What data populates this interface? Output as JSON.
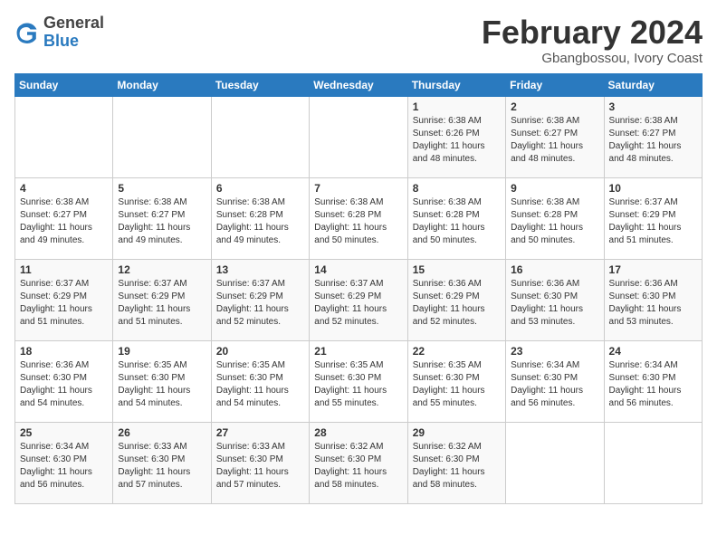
{
  "logo": {
    "general": "General",
    "blue": "Blue"
  },
  "title": "February 2024",
  "subtitle": "Gbangbossou, Ivory Coast",
  "days_header": [
    "Sunday",
    "Monday",
    "Tuesday",
    "Wednesday",
    "Thursday",
    "Friday",
    "Saturday"
  ],
  "weeks": [
    [
      {
        "day": "",
        "info": ""
      },
      {
        "day": "",
        "info": ""
      },
      {
        "day": "",
        "info": ""
      },
      {
        "day": "",
        "info": ""
      },
      {
        "day": "1",
        "info": "Sunrise: 6:38 AM\nSunset: 6:26 PM\nDaylight: 11 hours and 48 minutes."
      },
      {
        "day": "2",
        "info": "Sunrise: 6:38 AM\nSunset: 6:27 PM\nDaylight: 11 hours and 48 minutes."
      },
      {
        "day": "3",
        "info": "Sunrise: 6:38 AM\nSunset: 6:27 PM\nDaylight: 11 hours and 48 minutes."
      }
    ],
    [
      {
        "day": "4",
        "info": "Sunrise: 6:38 AM\nSunset: 6:27 PM\nDaylight: 11 hours and 49 minutes."
      },
      {
        "day": "5",
        "info": "Sunrise: 6:38 AM\nSunset: 6:27 PM\nDaylight: 11 hours and 49 minutes."
      },
      {
        "day": "6",
        "info": "Sunrise: 6:38 AM\nSunset: 6:28 PM\nDaylight: 11 hours and 49 minutes."
      },
      {
        "day": "7",
        "info": "Sunrise: 6:38 AM\nSunset: 6:28 PM\nDaylight: 11 hours and 50 minutes."
      },
      {
        "day": "8",
        "info": "Sunrise: 6:38 AM\nSunset: 6:28 PM\nDaylight: 11 hours and 50 minutes."
      },
      {
        "day": "9",
        "info": "Sunrise: 6:38 AM\nSunset: 6:28 PM\nDaylight: 11 hours and 50 minutes."
      },
      {
        "day": "10",
        "info": "Sunrise: 6:37 AM\nSunset: 6:29 PM\nDaylight: 11 hours and 51 minutes."
      }
    ],
    [
      {
        "day": "11",
        "info": "Sunrise: 6:37 AM\nSunset: 6:29 PM\nDaylight: 11 hours and 51 minutes."
      },
      {
        "day": "12",
        "info": "Sunrise: 6:37 AM\nSunset: 6:29 PM\nDaylight: 11 hours and 51 minutes."
      },
      {
        "day": "13",
        "info": "Sunrise: 6:37 AM\nSunset: 6:29 PM\nDaylight: 11 hours and 52 minutes."
      },
      {
        "day": "14",
        "info": "Sunrise: 6:37 AM\nSunset: 6:29 PM\nDaylight: 11 hours and 52 minutes."
      },
      {
        "day": "15",
        "info": "Sunrise: 6:36 AM\nSunset: 6:29 PM\nDaylight: 11 hours and 52 minutes."
      },
      {
        "day": "16",
        "info": "Sunrise: 6:36 AM\nSunset: 6:30 PM\nDaylight: 11 hours and 53 minutes."
      },
      {
        "day": "17",
        "info": "Sunrise: 6:36 AM\nSunset: 6:30 PM\nDaylight: 11 hours and 53 minutes."
      }
    ],
    [
      {
        "day": "18",
        "info": "Sunrise: 6:36 AM\nSunset: 6:30 PM\nDaylight: 11 hours and 54 minutes."
      },
      {
        "day": "19",
        "info": "Sunrise: 6:35 AM\nSunset: 6:30 PM\nDaylight: 11 hours and 54 minutes."
      },
      {
        "day": "20",
        "info": "Sunrise: 6:35 AM\nSunset: 6:30 PM\nDaylight: 11 hours and 54 minutes."
      },
      {
        "day": "21",
        "info": "Sunrise: 6:35 AM\nSunset: 6:30 PM\nDaylight: 11 hours and 55 minutes."
      },
      {
        "day": "22",
        "info": "Sunrise: 6:35 AM\nSunset: 6:30 PM\nDaylight: 11 hours and 55 minutes."
      },
      {
        "day": "23",
        "info": "Sunrise: 6:34 AM\nSunset: 6:30 PM\nDaylight: 11 hours and 56 minutes."
      },
      {
        "day": "24",
        "info": "Sunrise: 6:34 AM\nSunset: 6:30 PM\nDaylight: 11 hours and 56 minutes."
      }
    ],
    [
      {
        "day": "25",
        "info": "Sunrise: 6:34 AM\nSunset: 6:30 PM\nDaylight: 11 hours and 56 minutes."
      },
      {
        "day": "26",
        "info": "Sunrise: 6:33 AM\nSunset: 6:30 PM\nDaylight: 11 hours and 57 minutes."
      },
      {
        "day": "27",
        "info": "Sunrise: 6:33 AM\nSunset: 6:30 PM\nDaylight: 11 hours and 57 minutes."
      },
      {
        "day": "28",
        "info": "Sunrise: 6:32 AM\nSunset: 6:30 PM\nDaylight: 11 hours and 58 minutes."
      },
      {
        "day": "29",
        "info": "Sunrise: 6:32 AM\nSunset: 6:30 PM\nDaylight: 11 hours and 58 minutes."
      },
      {
        "day": "",
        "info": ""
      },
      {
        "day": "",
        "info": ""
      }
    ]
  ]
}
